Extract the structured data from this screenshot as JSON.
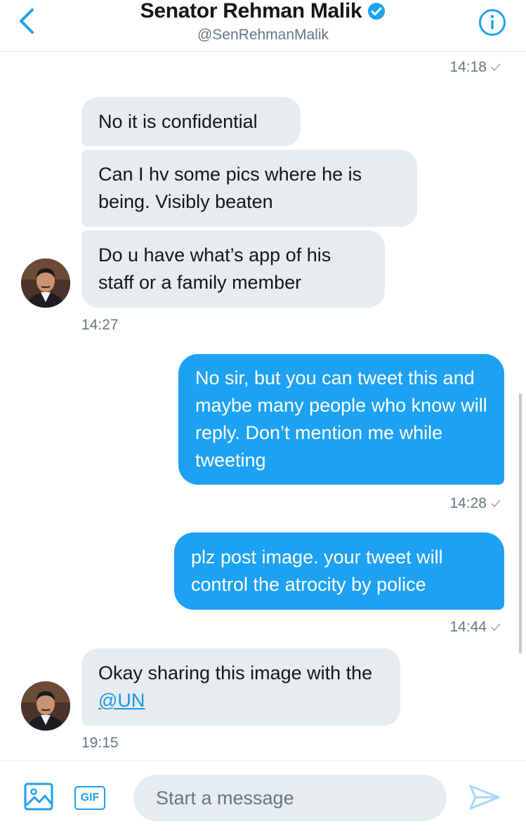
{
  "header": {
    "title": "Senator Rehman Malik",
    "handle": "@SenRehmanMalik"
  },
  "messages": [
    {
      "text": "No it is confidential"
    },
    {
      "text": "Can I hv some pics where he is being. Visibly beaten"
    },
    {
      "text": "Do u have what’s app of his staff or a family member"
    },
    {
      "text": "No sir, but you can tweet this and maybe many people who know will reply. Don’t mention me while tweeting"
    },
    {
      "text": "plz post image. your tweet will control the atrocity by police"
    },
    {
      "text_prefix": "Okay sharing this image with the ",
      "mention": "@UN"
    }
  ],
  "timestamps": {
    "t1": "14:18",
    "t2": "14:27",
    "t3": "14:28",
    "t4": "14:44",
    "t5": "19:15"
  },
  "composer": {
    "gif_label": "GIF",
    "placeholder": "Start a message"
  },
  "colors": {
    "accent": "#1da1f2",
    "incoming_bubble": "#e6ecf0",
    "secondary_text": "#657786"
  },
  "icons": [
    "back-chevron-icon",
    "verified-badge-icon",
    "info-icon",
    "check-icon",
    "image-icon",
    "send-icon"
  ]
}
